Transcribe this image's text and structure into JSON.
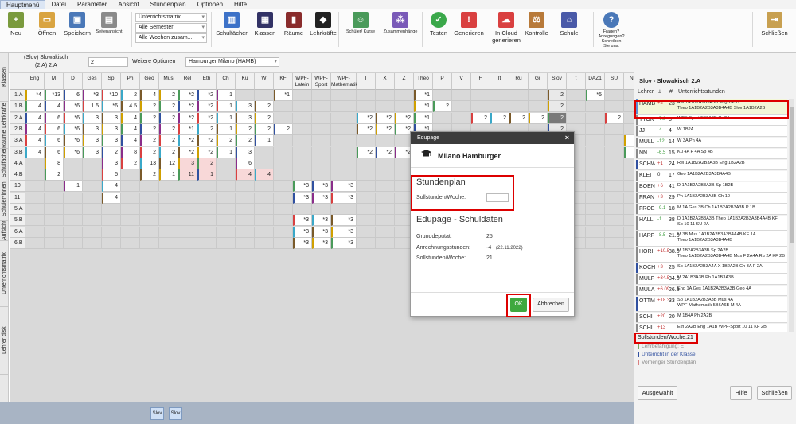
{
  "menu": [
    "Hauptmenü",
    "Datei",
    "Parameter",
    "Ansicht",
    "Stundenplan",
    "Optionen",
    "Hilfe"
  ],
  "ribbon": {
    "buttons": [
      {
        "label": "Neu",
        "color": "#7a9a3d"
      },
      {
        "label": "Öffnen",
        "color": "#d9a441"
      },
      {
        "label": "Speichern",
        "color": "#4a78b8"
      },
      {
        "label": "Seitenansicht",
        "color": "#8a8a8a"
      },
      {
        "label": "Schulfächer",
        "color": "#3d72c8"
      },
      {
        "label": "Klassen",
        "color": "#333366"
      },
      {
        "label": "Räume",
        "color": "#8a2d2d"
      },
      {
        "label": "Lehrkräfte",
        "color": "#222222"
      },
      {
        "label": "Schüler/ Kurse",
        "color": "#4a9a5a"
      },
      {
        "label": "Zusammenhänge",
        "color": "#7a5ab8"
      },
      {
        "label": "Testen",
        "color": "#3aa84a"
      },
      {
        "label": "Generieren",
        "color": "#d94040"
      },
      {
        "label": "In Cloud generieren",
        "color": "#d94040"
      },
      {
        "label": "Kontrolle",
        "color": "#b87a3a"
      },
      {
        "label": "Schule",
        "color": "#4a5aa8"
      },
      {
        "label": "Fragen? Anregungen? Schreiben Sie uns.",
        "color": "#4a78b8"
      },
      {
        "label": "Schließen",
        "color": "#c8a050"
      }
    ],
    "selects": [
      "Unterrichtsmatrix",
      "Alle Semester",
      "Alle Wochen zusam..."
    ]
  },
  "infobar": {
    "title": "(Slov) Slowakisch",
    "subtitle": "(2.A) 2.A",
    "input_value": "2",
    "options_label": "Weitere Optionen",
    "school_select": "Hamburger Milano (HAMB)"
  },
  "vtabs": [
    "Lehrer disk",
    "Unterrichtsmatrix",
    "Aufsicht",
    "Schüler*innen",
    "Schulfächer",
    "Räume",
    "Lehrkräfte",
    "Klassen"
  ],
  "grid": {
    "columns": [
      "Eng",
      "M",
      "D",
      "Ges",
      "Sp",
      "Ph",
      "Geo",
      "Mus",
      "Rel",
      "Eth",
      "Ch",
      "Ku",
      "W",
      "KF",
      "WPF-Latein",
      "WPF-Sport",
      "WPF-Mathematik",
      "T",
      "X",
      "Z",
      "Theo",
      "P",
      "V",
      "F",
      "It",
      "Ru",
      "Gr",
      "Slov",
      "t",
      "DAZ1",
      "SU",
      "NB",
      "+"
    ],
    "rows": [
      {
        "label": "1.A",
        "cells": [
          "*4",
          "*13",
          "6",
          "*3",
          "*10",
          "2",
          "4",
          "2",
          "*2",
          "*2",
          "1",
          "",
          "",
          "*1",
          "",
          "",
          "",
          "",
          "",
          "",
          "*1",
          "",
          "",
          "",
          "",
          "",
          "",
          "2",
          "",
          "*5",
          "",
          "",
          "*51"
        ]
      },
      {
        "label": "1.B",
        "cells": [
          "4",
          "4",
          "*6",
          "1.5",
          "*6",
          "4.5",
          "2",
          "2",
          "*2",
          "*2",
          "1",
          "3",
          "2",
          "",
          "",
          "",
          "",
          "",
          "",
          "",
          "*1",
          "2",
          "",
          "",
          "",
          "",
          "",
          "2",
          "",
          "",
          "",
          "",
          "*47"
        ]
      },
      {
        "label": "2.A",
        "cells": [
          "4",
          "6",
          "*6",
          "3",
          "3",
          "4",
          "2",
          "2",
          "*2",
          "*2",
          "1",
          "3",
          "2",
          "",
          "",
          "",
          "",
          "*2",
          "*2",
          "*2",
          "*1",
          "",
          "",
          "2",
          "2",
          "2",
          "2",
          "2",
          "",
          "",
          "2",
          "",
          "*52"
        ]
      },
      {
        "label": "2.B",
        "cells": [
          "4",
          "6",
          "*6",
          "3",
          "3",
          "4",
          "2",
          "2",
          "*1",
          "2",
          "1",
          "2",
          "2",
          "2",
          "",
          "",
          "",
          "*2",
          "*2",
          "*2",
          "*1",
          "",
          "",
          "",
          "",
          "",
          "",
          "2",
          "",
          "",
          "",
          "",
          "*43"
        ]
      },
      {
        "label": "3.A",
        "cells": [
          "4",
          "6",
          "*6",
          "3",
          "3",
          "4",
          "2",
          "2",
          "*2",
          "*2",
          "2",
          "2",
          "1",
          "",
          "",
          "",
          "",
          "",
          "",
          "",
          "*1",
          "",
          "",
          "",
          "",
          "",
          "",
          "2",
          "",
          "",
          "",
          "16",
          "*53"
        ]
      },
      {
        "label": "3.B",
        "cells": [
          "4",
          "6",
          "*6",
          "3",
          "2",
          "8",
          "2",
          "2",
          "*2",
          "*2",
          "1",
          "3",
          "",
          "",
          "",
          "",
          "",
          "*2",
          "*2",
          "*2",
          "*1",
          "",
          "",
          "",
          "",
          "",
          "",
          "2",
          "",
          "",
          "",
          "16",
          "*55"
        ]
      },
      {
        "label": "4.A",
        "cells": [
          "",
          "8",
          "",
          "",
          "3",
          "2",
          "13",
          "12",
          "3",
          "2",
          "",
          "6",
          "",
          "",
          "",
          "",
          "",
          "",
          "",
          "",
          "",
          "",
          "",
          "",
          "",
          "",
          "",
          "",
          "",
          "",
          "",
          "",
          "*55"
        ]
      },
      {
        "label": "4.B",
        "cells": [
          "",
          "2",
          "",
          "",
          "5",
          "",
          "2",
          "1",
          "11",
          "1",
          "",
          "4",
          "4",
          "",
          "",
          "",
          "",
          "",
          "",
          "",
          "",
          "",
          "",
          "",
          "",
          "",
          "",
          "",
          "",
          "",
          "",
          "",
          "*32"
        ]
      },
      {
        "label": "10",
        "cells": [
          "",
          "",
          "1",
          "",
          "4",
          "",
          "",
          "",
          "",
          "",
          "",
          "",
          "",
          "",
          "*3",
          "*3",
          "*3",
          "",
          "",
          "",
          "",
          "",
          "",
          "",
          "",
          "",
          "",
          "",
          "",
          "",
          "",
          "",
          "1"
        ]
      },
      {
        "label": "11",
        "cells": [
          "",
          "",
          "",
          "",
          "4",
          "",
          "",
          "",
          "",
          "",
          "",
          "",
          "",
          "",
          "*3",
          "*3",
          "*3",
          "",
          "",
          "",
          "",
          "",
          "",
          "",
          "",
          "",
          "",
          "",
          "",
          "",
          "",
          "",
          "0"
        ]
      },
      {
        "label": "5.A",
        "cells": [
          "",
          "",
          "",
          "",
          "",
          "",
          "",
          "",
          "",
          "",
          "",
          "",
          "",
          "",
          "",
          "",
          "",
          "",
          "",
          "",
          "",
          "",
          "",
          "",
          "",
          "",
          "",
          "",
          "",
          "",
          "",
          "",
          "*3"
        ]
      },
      {
        "label": "5.B",
        "cells": [
          "",
          "",
          "",
          "",
          "",
          "",
          "",
          "",
          "",
          "",
          "",
          "",
          "",
          "",
          "*3",
          "*3",
          "*3",
          "",
          "",
          "",
          "",
          "",
          "",
          "",
          "",
          "",
          "",
          "",
          "",
          "",
          "",
          "",
          "*9"
        ]
      },
      {
        "label": "6.A",
        "cells": [
          "",
          "",
          "",
          "",
          "",
          "",
          "",
          "",
          "",
          "",
          "",
          "",
          "",
          "",
          "*3",
          "*3",
          "*3",
          "",
          "",
          "",
          "",
          "",
          "",
          "",
          "",
          "",
          "",
          "",
          "",
          "",
          "",
          "",
          "*9"
        ]
      },
      {
        "label": "6.B",
        "cells": [
          "",
          "",
          "",
          "",
          "",
          "",
          "",
          "",
          "",
          "",
          "",
          "",
          "",
          "",
          "*3",
          "*3",
          "*3",
          "",
          "",
          "",
          "",
          "",
          "",
          "",
          "",
          "",
          "",
          "",
          "",
          "",
          "",
          "",
          "*9"
        ]
      }
    ]
  },
  "status_buttons": [
    "Slov",
    "Slov"
  ],
  "right_panel": {
    "title": "Slov - Slowakisch  2.A",
    "header": [
      "Lehrer",
      "±",
      "#",
      "Unterrichtsstunden"
    ],
    "teachers": [
      {
        "name": "HAMB",
        "diff": "+2",
        "count": "23",
        "detail": "Rel 1A1B2A2B3A3B Eng 2A3B",
        "detail2": "Theo 1A1B2A2B3A3B4A4B Slov 1A1B2A2B",
        "color": "#5a8fd8",
        "highlight": true
      },
      {
        "name": "TTOK",
        "diff": "-7.8",
        "count": "8",
        "detail": "WPF-Sport 5B6A6B Gr 2A",
        "detail2": "",
        "color": "#8a8a8a"
      },
      {
        "name": "JJ",
        "diff": "-4",
        "count": "4",
        "detail": "W 1B2A",
        "detail2": "",
        "color": "#8a8a8a"
      },
      {
        "name": "MULL",
        "diff": "-12",
        "count": "14",
        "detail": "W 3A Ph 4A",
        "detail2": "",
        "color": "#8a8a8a"
      },
      {
        "name": "NN",
        "diff": "-6.5",
        "count": "15",
        "detail": "Ku 4A F 4A Sp 4B",
        "detail2": "",
        "color": "#8a8a8a"
      },
      {
        "name": "SCHW",
        "diff": "+1",
        "count": "24",
        "detail": "Rel 1A1B2A2B3A3B Eng 1B2A2B",
        "detail2": "",
        "color": "#3050a0"
      },
      {
        "name": "KLEI",
        "diff": "0",
        "count": "17",
        "detail": "Geo 1A1B2A2B3A3B4A4B",
        "detail2": "",
        "color": "#8a8a8a"
      },
      {
        "name": "BOEN",
        "diff": "+6",
        "count": "41",
        "detail": "D 1A1B2A2B3A3B Sp 1B2B",
        "detail2": "",
        "color": "#8a8a8a"
      },
      {
        "name": "FRAN",
        "diff": "+3",
        "count": "29",
        "detail": "Ph 1A1B2A2B3A3B Ch 10",
        "detail2": "",
        "color": "#8a8a8a"
      },
      {
        "name": "FROE",
        "diff": "-9.1",
        "count": "18",
        "detail": "M 1A Ges 3B Ch 1A1B2A2B3A3B P 1B",
        "detail2": "",
        "color": "#8a8a8a"
      },
      {
        "name": "HALL",
        "diff": "-1",
        "count": "38",
        "detail": "D 1A1B2A2B3A3B Theo 1A1B2A2B3A3B4A4B KF",
        "detail2": "Sp 10 11 SU 2A",
        "color": "#8a8a8a"
      },
      {
        "name": "HARF",
        "diff": "-8.5",
        "count": "21.5",
        "detail": "M 3B Mus 1A1B2A2B3A3B4A4B KF 1A",
        "detail2": "Theo 1A1B2A2B3A3B4A4B",
        "color": "#8a8a8a"
      },
      {
        "name": "HORI",
        "diff": "+10.5",
        "count": "38.5",
        "detail": "M 1B2A2B3A3B Sp 2A2B",
        "detail2": "Theo 1A1B2A2B3A3B4A4B Mus F 2A4A Ru 2A KF 2B",
        "color": "#8a8a8a"
      },
      {
        "name": "KOCH",
        "diff": "+3",
        "count": "25",
        "detail": "Sp 1A1B2A2B3A4A X 1B2A2B Ch 3A F 2A",
        "detail2": "",
        "color": "#3050a0"
      },
      {
        "name": "MULF",
        "diff": "+34.5",
        "count": "34.5",
        "detail": "M 2A1B3A3B Ph 1A1B3A3B",
        "detail2": "",
        "color": "#8a8a8a"
      },
      {
        "name": "MULA",
        "diff": "+6.09",
        "count": "26.5",
        "detail": "Eng 1A Ges 1A1B2A2B3A3B Geo 4A",
        "detail2": "",
        "color": "#8a8a8a"
      },
      {
        "name": "OTTM",
        "diff": "+18.3",
        "count": "33",
        "detail": "Sp 1A1B2A2B3A3B Mus 4A",
        "detail2": "WPF-Mathematik 5B6A6B M 4A",
        "color": "#3050a0"
      },
      {
        "name": "SCHI",
        "diff": "+20",
        "count": "20",
        "detail": "M 1B4A Ph 2A2B",
        "detail2": "",
        "color": "#8a8a8a"
      },
      {
        "name": "SCHI",
        "diff": "+13",
        "count": "",
        "detail": "Eth 2A2B Eng 1A1B WPF-Sport 10 11 KF 2B",
        "detail2": "",
        "color": "#8a8a8a"
      }
    ],
    "sollstunden": "Sollstunden/Woche:21",
    "legend": [
      "Lehrbefähigung: E",
      "Unterricht in der Klasse",
      "Vorheriger Stundenplan"
    ],
    "legend_colors": [
      "#7aa860",
      "#3050a0",
      "#d98080"
    ],
    "buttons": [
      "Ausgewählt",
      "Hilfe",
      "Schließen"
    ]
  },
  "dialog": {
    "window_title": "Edupage",
    "name": "Milano Hamburger",
    "section1": "Stundenplan",
    "soll_label": "Sollstunden/Woche:",
    "soll_value": "",
    "section2": "Edupage - Schuldaten",
    "grunddeputat_label": "Grunddeputat:",
    "grunddeputat": "25",
    "anrechnung_label": "Anrechnungsstunden:",
    "anrechnung": "-4",
    "anrechnung_date": "(22.11.2022)",
    "soll2_label": "Sollstunden/Woche:",
    "soll2": "21",
    "ok": "OK",
    "cancel": "Abbrechen"
  }
}
